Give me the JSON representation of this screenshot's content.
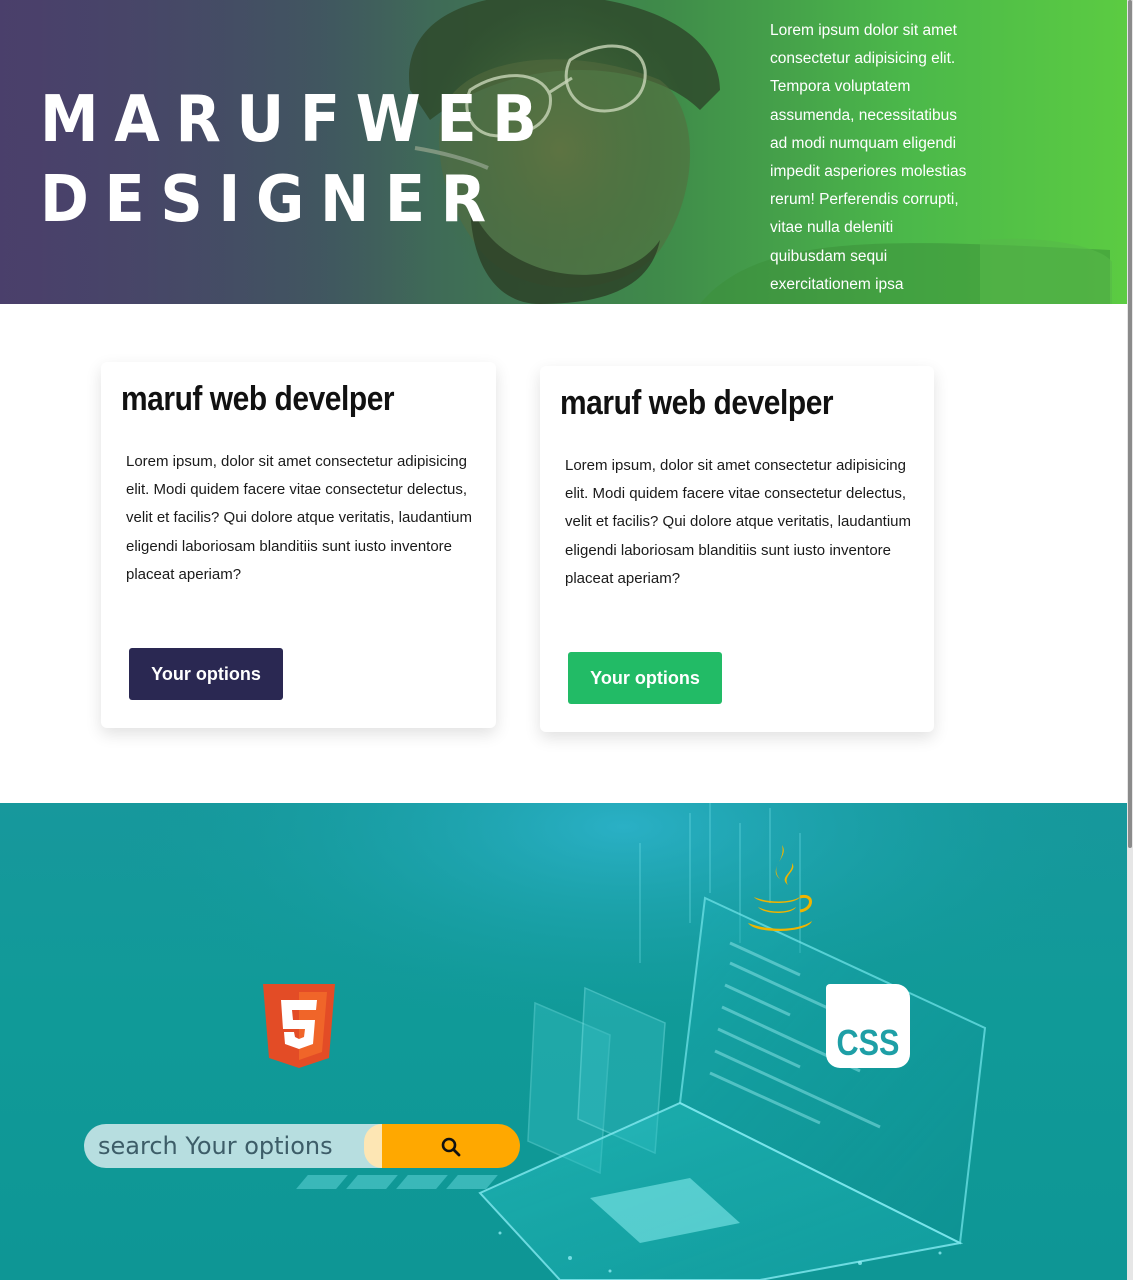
{
  "hero": {
    "title_line1": "MARUFWEB",
    "title_line2": "DESIGNER",
    "text": "Lorem ipsum dolor sit amet consectetur adipisicing elit. Tempora voluptatem assumenda, necessitatibus ad modi numquam eligendi impedit asperiores molestias rerum! Perferendis corrupti, vitae nulla deleniti quibusdam sequi exercitationem ipsa"
  },
  "cards": [
    {
      "title": "maruf web develper",
      "body": "Lorem ipsum, dolor sit amet consectetur adipisicing elit. Modi quidem facere vitae consectetur delectus, velit et facilis? Qui dolore atque veritatis, laudantium eligendi laboriosam blanditiis sunt iusto inventore placeat aperiam?",
      "button_label": "Your options",
      "button_color": "#2a2852"
    },
    {
      "title": "maruf web develper",
      "body": "Lorem ipsum, dolor sit amet consectetur adipisicing elit. Modi quidem facere vitae consectetur delectus, velit et facilis? Qui dolore atque veritatis, laudantium eligendi laboriosam blanditiis sunt iusto inventore placeat aperiam?",
      "button_label": "Your options",
      "button_color": "#22bb66"
    }
  ],
  "tech": {
    "icons": [
      "html5-icon",
      "java-icon",
      "css-icon"
    ],
    "css_label": "CSS",
    "search": {
      "placeholder": "search Your options",
      "button_icon": "search-icon",
      "button_color": "#ffa800"
    }
  },
  "colors": {
    "hero_gradient_start": "#4a3f6b",
    "hero_gradient_end": "#5ccc42",
    "tech_background": "#109a98"
  }
}
